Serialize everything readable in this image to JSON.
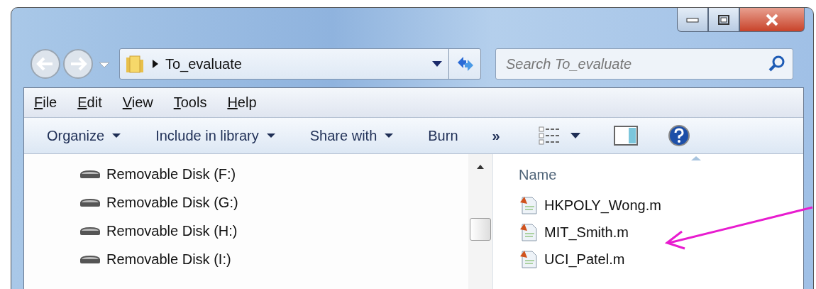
{
  "address_bar": {
    "path": "To_evaluate"
  },
  "search": {
    "placeholder": "Search To_evaluate"
  },
  "menu": [
    {
      "label": "File"
    },
    {
      "label": "Edit"
    },
    {
      "label": "View"
    },
    {
      "label": "Tools"
    },
    {
      "label": "Help"
    }
  ],
  "toolbar": [
    {
      "label": "Organize",
      "kind": "dropdown"
    },
    {
      "label": "Include in library",
      "kind": "dropdown"
    },
    {
      "label": "Share with",
      "kind": "dropdown"
    },
    {
      "label": "Burn",
      "kind": "plain"
    },
    {
      "label": "»",
      "kind": "overflow"
    }
  ],
  "nav_pane": {
    "items": [
      {
        "label": "Removable Disk (F:)"
      },
      {
        "label": "Removable Disk (G:)"
      },
      {
        "label": "Removable Disk (H:)"
      },
      {
        "label": "Removable Disk (I:)"
      }
    ]
  },
  "files": {
    "column": "Name",
    "items": [
      {
        "name": "HKPOLY_Wong.m"
      },
      {
        "name": "MIT_Smith.m"
      },
      {
        "name": "UCI_Patel.m"
      }
    ]
  }
}
